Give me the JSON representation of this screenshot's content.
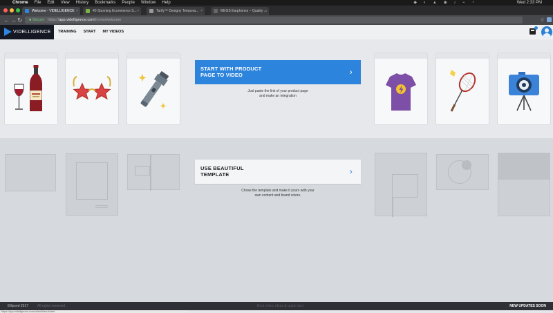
{
  "menubar": {
    "app_name": "Chrome",
    "menus": [
      "File",
      "Edit",
      "View",
      "History",
      "Bookmarks",
      "People",
      "Window",
      "Help"
    ],
    "clock": "Wed 2:33 PM"
  },
  "tabs": [
    {
      "title": "Welcome - VIDELLIGENCE",
      "active": true,
      "favicon_color": "#2e86de"
    },
    {
      "title": "40 Stunning Ecommerce S...",
      "active": false,
      "favicon_color": "#7cb342"
    },
    {
      "title": "Tarify™ Designy Tempora...",
      "active": false,
      "favicon_color": "#999999"
    },
    {
      "title": "MEGS Earphones – Quality ...",
      "active": false,
      "favicon_color": "#666666"
    }
  ],
  "address_bar": {
    "secure_label": "Secure",
    "url_scheme": "https://",
    "url_host": "app.videlligence.com",
    "url_path": "/home/welcome"
  },
  "app": {
    "brand": "VIDELLIGENCE",
    "nav": [
      "TRAINING",
      "START",
      "MY VIDEOS"
    ],
    "accent_color": "#2d84dc"
  },
  "product_cards": {
    "left": [
      "wine-bottle-glass",
      "star-sunglasses",
      "flashlight"
    ],
    "right": [
      "lightning-tshirt",
      "badminton-racket",
      "camera-on-tripod"
    ]
  },
  "cta_product": {
    "line1": "START WITH PRODUCT",
    "line2": "PAGE TO VIDEO",
    "sub1": "Just paste the link of your product page",
    "sub2": "and make an integration"
  },
  "cta_template": {
    "line1": "USE BEAUTIFUL",
    "line2": "TEMPLATE",
    "sub1": "Chose the template and make it yours with your",
    "sub2": "own content and brand colors."
  },
  "footer": {
    "copyright": "Ellipsed 2017",
    "rights": "All rights reserved",
    "made_with": "Best video, ideas & quick start",
    "updates": "NEW UPDATES SOON"
  },
  "status_url": "https://app.videlligence.com/videoWizard/start"
}
